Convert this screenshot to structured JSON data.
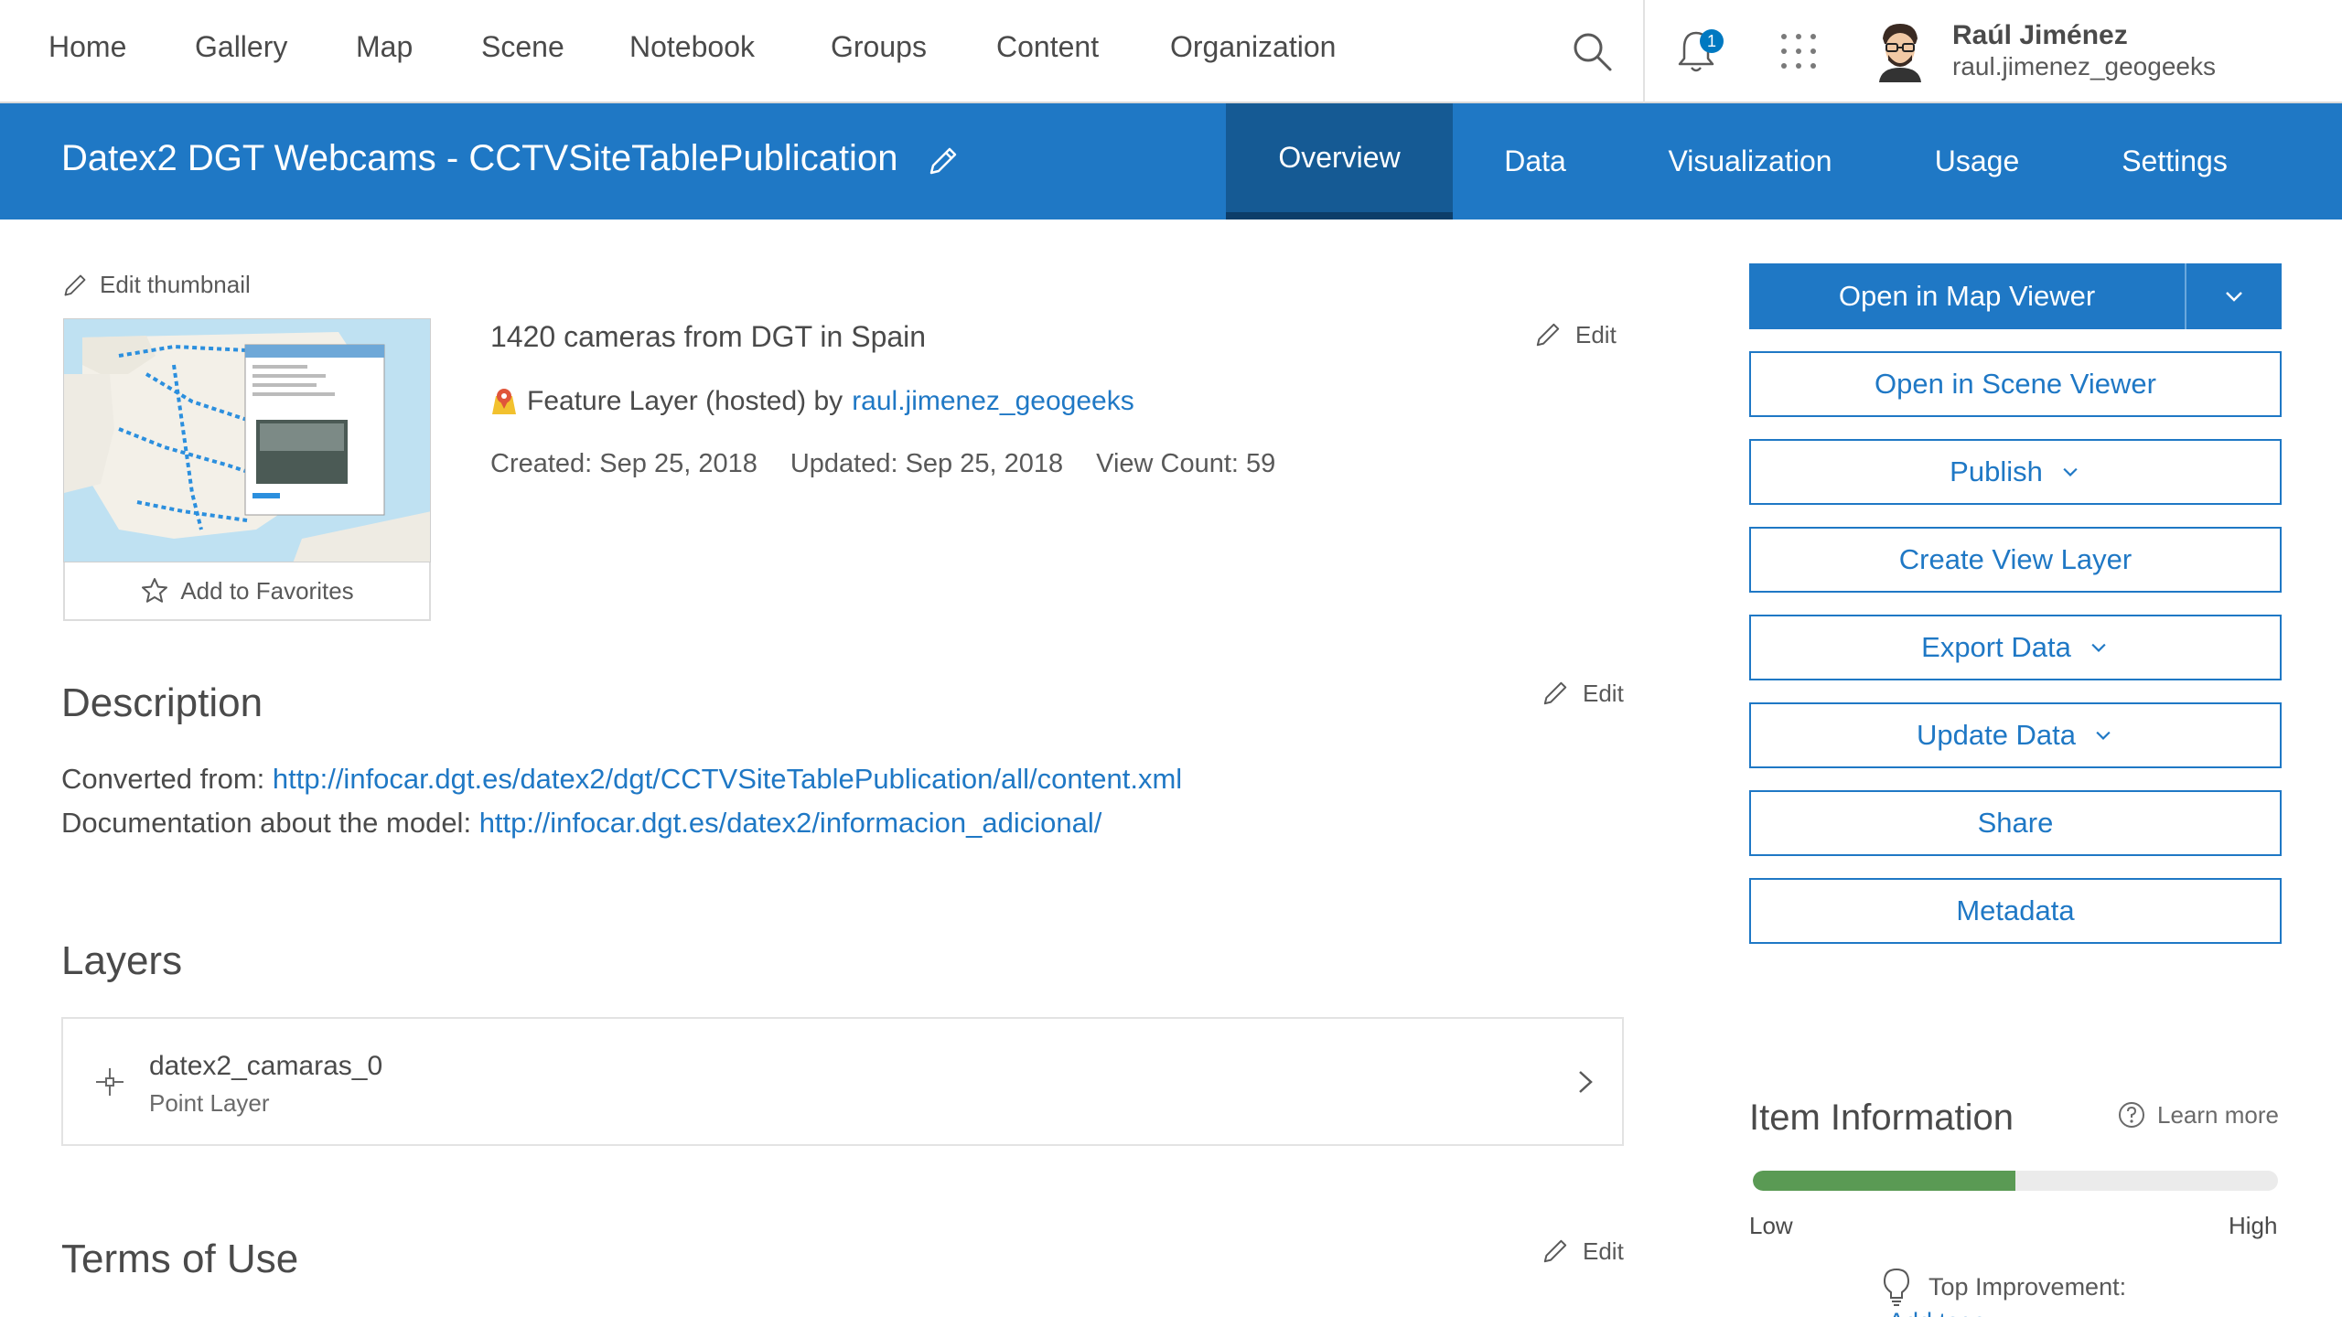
{
  "nav": {
    "items": [
      "Home",
      "Gallery",
      "Map",
      "Scene",
      "Notebook",
      "Groups",
      "Content",
      "Organization"
    ],
    "notification_count": "1",
    "user_name": "Raúl Jiménez",
    "user_id": "raul.jimenez_geogeeks"
  },
  "titlebar": {
    "title": "Datex2 DGT Webcams - CCTVSiteTablePublication",
    "tabs": [
      "Overview",
      "Data",
      "Visualization",
      "Usage",
      "Settings"
    ],
    "active_tab": "Overview"
  },
  "item": {
    "edit_thumbnail": "Edit thumbnail",
    "add_favorites": "Add to Favorites",
    "summary": "1420 cameras from DGT in Spain",
    "type_text": "Feature Layer (hosted) by",
    "owner": "raul.jimenez_geogeeks",
    "created": "Created: Sep 25, 2018",
    "updated": "Updated: Sep 25, 2018",
    "view_count": "View Count: 59",
    "edit_label": "Edit"
  },
  "description": {
    "heading": "Description",
    "line1_label": "Converted from:",
    "line1_link": "http://infocar.dgt.es/datex2/dgt/CCTVSiteTablePublication/all/content.xml",
    "line2_label": "Documentation about the model:",
    "line2_link": "http://infocar.dgt.es/datex2/informacion_adicional/"
  },
  "layers": {
    "heading": "Layers",
    "items": [
      {
        "name": "datex2_camaras_0",
        "type": "Point Layer"
      }
    ]
  },
  "terms": {
    "heading": "Terms of Use"
  },
  "actions": {
    "open_map_viewer": "Open in Map Viewer",
    "open_scene_viewer": "Open in Scene Viewer",
    "publish": "Publish",
    "create_view_layer": "Create View Layer",
    "export_data": "Export Data",
    "update_data": "Update Data",
    "share": "Share",
    "metadata": "Metadata"
  },
  "item_info": {
    "heading": "Item Information",
    "learn_more": "Learn more",
    "score_fraction": 0.5,
    "low": "Low",
    "high": "High",
    "top_improvement": "Top Improvement:",
    "improvement_link": "Add tags"
  },
  "colors": {
    "brand_blue": "#1f78c5",
    "active_tab": "#155a94",
    "progress_green": "#5a9a54"
  }
}
